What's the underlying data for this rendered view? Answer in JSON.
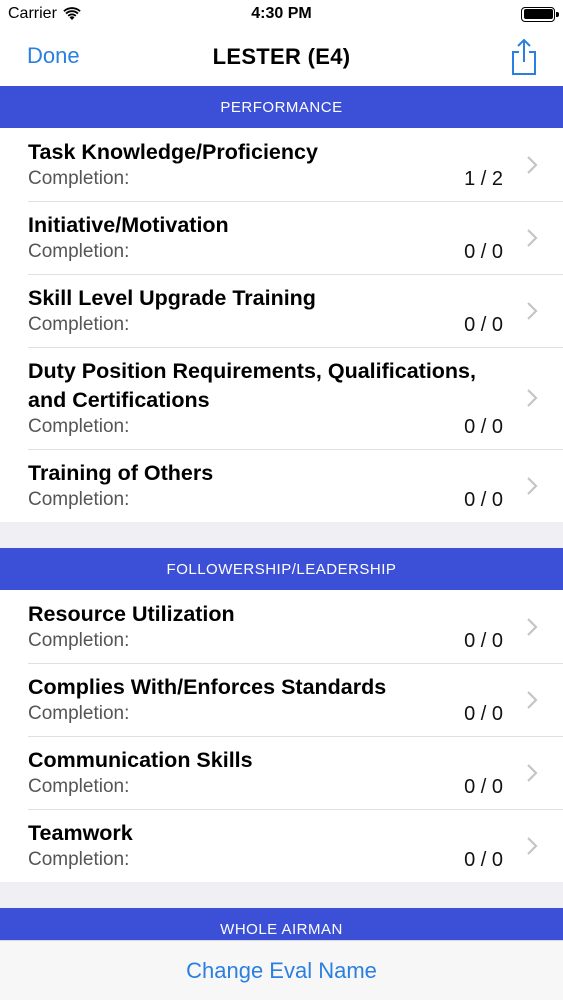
{
  "status": {
    "carrier": "Carrier",
    "time": "4:30 PM"
  },
  "nav": {
    "done": "Done",
    "title": "LESTER (E4)"
  },
  "sections": [
    {
      "header": "PERFORMANCE",
      "rows": [
        {
          "title": "Task Knowledge/Proficiency",
          "label": "Completion:",
          "value": "1 / 2"
        },
        {
          "title": "Initiative/Motivation",
          "label": "Completion:",
          "value": "0 / 0"
        },
        {
          "title": "Skill Level Upgrade Training",
          "label": "Completion:",
          "value": "0 / 0"
        },
        {
          "title": "Duty Position Requirements, Qualifications, and Certifications",
          "label": "Completion:",
          "value": "0 / 0"
        },
        {
          "title": "Training of Others",
          "label": "Completion:",
          "value": "0 / 0"
        }
      ]
    },
    {
      "header": "FOLLOWERSHIP/LEADERSHIP",
      "rows": [
        {
          "title": "Resource Utilization",
          "label": "Completion:",
          "value": "0 / 0"
        },
        {
          "title": "Complies With/Enforces Standards",
          "label": "Completion:",
          "value": "0 / 0"
        },
        {
          "title": "Communication Skills",
          "label": "Completion:",
          "value": "0 / 0"
        },
        {
          "title": "Teamwork",
          "label": "Completion:",
          "value": "0 / 0"
        }
      ]
    },
    {
      "header": "WHOLE AIRMAN",
      "rows": []
    }
  ],
  "bottom": {
    "button": "Change Eval Name"
  },
  "colors": {
    "accent": "#2a7fe0",
    "section_header": "#3b50d6"
  }
}
